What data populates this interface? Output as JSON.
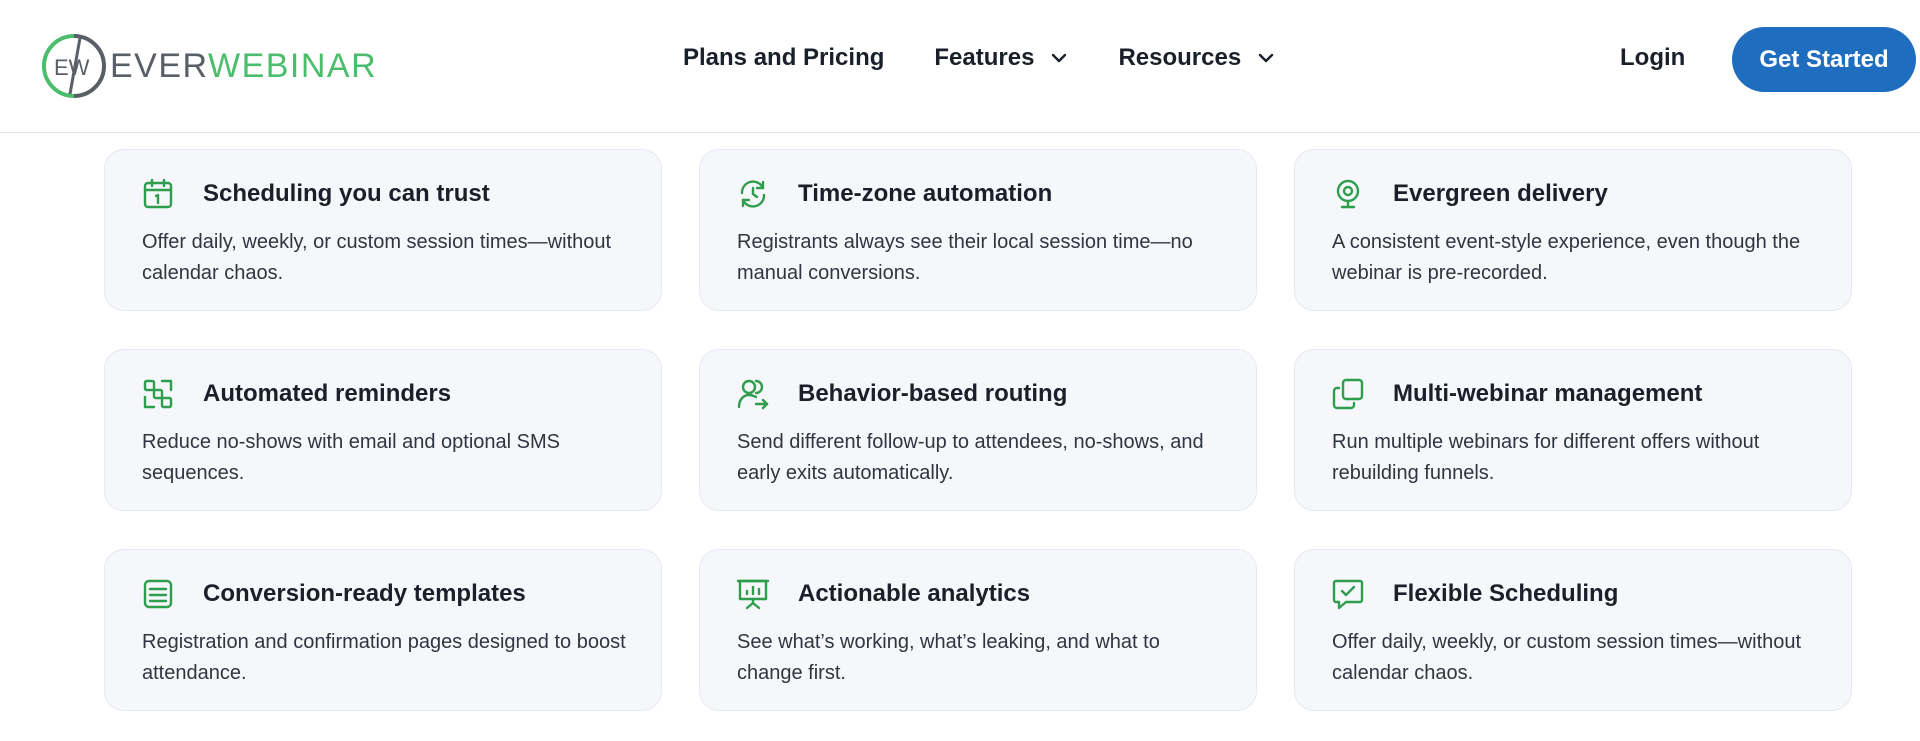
{
  "brand": {
    "name_part1": "EVER",
    "name_part2": "WEBINAR",
    "mark_letters": "EW"
  },
  "nav": {
    "pricing": "Plans and Pricing",
    "features": "Features",
    "resources": "Resources"
  },
  "header_actions": {
    "login": "Login",
    "cta": "Get Started"
  },
  "colors": {
    "accent_green": "#2e9e4d",
    "cta_blue": "#1f6dbf",
    "card_bg": "#f5f7fa"
  },
  "features": [
    {
      "icon": "calendar-icon",
      "title": "Scheduling you can trust",
      "desc": "Offer daily, weekly, or custom session times—without calendar chaos."
    },
    {
      "icon": "clock-refresh-icon",
      "title": "Time-zone automation",
      "desc": "Registrants always see their local session time—no manual conversions."
    },
    {
      "icon": "webcam-icon",
      "title": "Evergreen delivery",
      "desc": "A consistent event-style experience, even though the webinar is pre-recorded."
    },
    {
      "icon": "scan-reminder-icon",
      "title": "Automated reminders",
      "desc": "Reduce no-shows with email and optional SMS sequences."
    },
    {
      "icon": "user-route-icon",
      "title": "Behavior-based routing",
      "desc": "Send different follow-up to attendees, no-shows, and early exits automatically."
    },
    {
      "icon": "copy-windows-icon",
      "title": "Multi-webinar management",
      "desc": "Run multiple webinars for different offers without rebuilding funnels."
    },
    {
      "icon": "template-lines-icon",
      "title": "Conversion-ready templates",
      "desc": "Registration and confirmation pages designed to boost attendance."
    },
    {
      "icon": "presentation-chart-icon",
      "title": "Actionable analytics",
      "desc": "See what’s working, what’s leaking, and what to change first."
    },
    {
      "icon": "chat-check-icon",
      "title": "Flexible Scheduling",
      "desc": "Offer daily, weekly, or custom session times—without calendar chaos."
    }
  ]
}
